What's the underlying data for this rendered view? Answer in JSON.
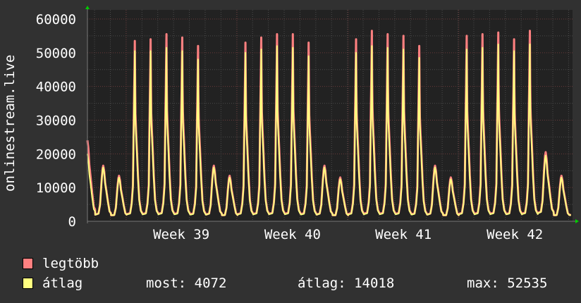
{
  "chart_data": {
    "type": "line",
    "ylabel": "onlinestream.live",
    "ylim": [
      0,
      60000
    ],
    "y_ticks": [
      0,
      10000,
      20000,
      30000,
      40000,
      50000,
      60000
    ],
    "y_tick_labels": [
      "0",
      "10000",
      "20000",
      "30000",
      "40000",
      "50000",
      "60000"
    ],
    "x_unit": "days",
    "xlim": [
      0,
      30.7
    ],
    "x_tick_labels": [
      {
        "label": "Week 39",
        "x": 5.94
      },
      {
        "label": "Week 40",
        "x": 12.98
      },
      {
        "label": "Week 41",
        "x": 20.0
      },
      {
        "label": "Week 42",
        "x": 27.05
      }
    ],
    "week_boundaries": [
      2.45,
      9.46,
      16.5,
      23.5
    ],
    "grid": true,
    "peak_days": [
      0,
      1,
      2,
      3,
      4,
      5,
      6,
      7,
      8,
      9,
      10,
      11,
      12,
      13,
      14,
      15,
      16,
      17,
      18,
      19,
      20,
      21,
      22,
      23,
      24,
      25,
      26,
      27,
      28,
      29,
      30
    ],
    "series": [
      {
        "name": "legtöbb",
        "color": "#ff8080",
        "daily_peaks": [
          24000,
          16500,
          13500,
          53500,
          54000,
          55500,
          54500,
          52000,
          16500,
          13500,
          53000,
          54500,
          55500,
          55500,
          53000,
          16500,
          13000,
          54000,
          56500,
          55500,
          55000,
          52000,
          16500,
          13000,
          55000,
          55500,
          56000,
          54000,
          56500,
          20500,
          13500
        ]
      },
      {
        "name": "átlag",
        "color": "#ffff80",
        "daily_peaks": [
          20000,
          16000,
          13000,
          50500,
          50500,
          51500,
          50500,
          48000,
          16000,
          13000,
          50000,
          51000,
          52000,
          51500,
          49000,
          16000,
          12500,
          50000,
          52000,
          51500,
          51000,
          48500,
          16000,
          12500,
          51000,
          51500,
          52500,
          50500,
          52535,
          19500,
          13000
        ]
      }
    ],
    "legend": {
      "items": [
        {
          "label": "legtöbb",
          "color": "#ff8080"
        },
        {
          "label": "átlag",
          "color": "#ffff80"
        }
      ],
      "stats": {
        "most": "most: 4072",
        "atlag": "átlag: 14018",
        "max": "max: 52535"
      }
    }
  }
}
